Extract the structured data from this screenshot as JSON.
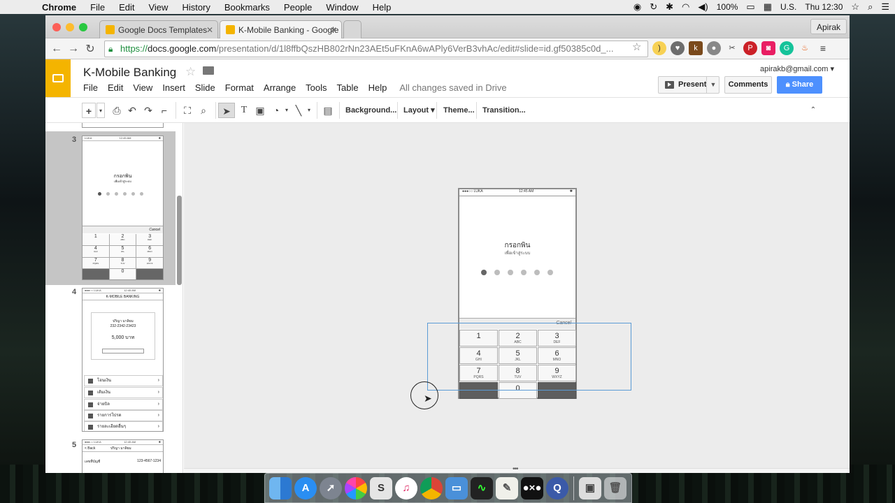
{
  "menubar": {
    "app": "Chrome",
    "items": [
      "File",
      "Edit",
      "View",
      "History",
      "Bookmarks",
      "People",
      "Window",
      "Help"
    ],
    "battery": "100%",
    "input_source": "U.S.",
    "clock": "Thu 12:30"
  },
  "browser": {
    "tabs": [
      {
        "title": "Google Docs Templates",
        "icon_color": "#f4b400"
      },
      {
        "title": "K-Mobile Banking - Google",
        "icon_color": "#f4b400"
      }
    ],
    "profile": "Apirak",
    "url": {
      "scheme": "https://",
      "domain": "docs.google.com",
      "path": "/presentation/d/1l8ffbQszHB802rNn23AEt5uFKnA6wAPly6VerB3vhAc/edit#slide=id.gf50385c0d_..."
    },
    "extensions": [
      "bookmark-icon",
      "pocket-icon",
      "k-icon",
      "ghost-icon",
      "tools-icon",
      "pinterest-icon",
      "camera-icon",
      "grammarly-icon",
      "flame-icon",
      "hamburger-icon"
    ]
  },
  "docs": {
    "title": "K-Mobile Banking",
    "menu": [
      "File",
      "Edit",
      "View",
      "Insert",
      "Slide",
      "Format",
      "Arrange",
      "Tools",
      "Table",
      "Help"
    ],
    "save_status": "All changes saved in Drive",
    "account": "apirakb@gmail.com",
    "present_label": "Present",
    "comments_label": "Comments",
    "share_label": "Share",
    "toolbar_text": {
      "background": "Background...",
      "layout": "Layout",
      "theme": "Theme...",
      "transition": "Transition..."
    }
  },
  "filmstrip": {
    "slide_numbers": [
      "3",
      "4",
      "5"
    ],
    "thumb3": {
      "carrier": "LUKA",
      "time": "12:45 AM",
      "title": "กรอกพิน",
      "subtitle": "เพื่อเข้าสู่ระบบ",
      "cancel": "Cancel"
    },
    "thumb4": {
      "header": "K-MOBILE BANKING",
      "account_name": "ปริญา มาลิยม",
      "account_no": "232-2342-23423",
      "amount": "5,000 บาท",
      "menu": [
        "โอนเงิน",
        "เติมเงิน",
        "จ่ายบิล",
        "รายการโปรด",
        "รายละเอียดอื่นๆ"
      ]
    },
    "thumb5": {
      "back": "< Back",
      "name": "ปริญา มาลิยม",
      "label": "เลขที่บัญชี",
      "value": "123-4567-1234"
    }
  },
  "slide": {
    "status_carrier": "●●●○○ LUKA",
    "status_time": "12:45 AM",
    "status_bt": "✱",
    "title": "กรอกพิน",
    "subtitle": "เพื่อเข้าสู่ระบบ",
    "pin_entered": 1,
    "pin_length": 6,
    "cancel": "Cancel",
    "keys": [
      {
        "n": "1",
        "l": ""
      },
      {
        "n": "2",
        "l": "ABC"
      },
      {
        "n": "3",
        "l": "DEF"
      },
      {
        "n": "4",
        "l": "GHI"
      },
      {
        "n": "5",
        "l": "JKL"
      },
      {
        "n": "6",
        "l": "MNO"
      },
      {
        "n": "7",
        "l": "PQRS"
      },
      {
        "n": "8",
        "l": "TUV"
      },
      {
        "n": "9",
        "l": "WXYZ"
      },
      {
        "n": "",
        "l": ""
      },
      {
        "n": "0",
        "l": ""
      },
      {
        "n": "",
        "l": ""
      }
    ]
  },
  "dock": [
    "finder",
    "app-store",
    "rocket",
    "photos",
    "scrivener",
    "itunes",
    "chrome",
    "keynote",
    "activity",
    "textedit",
    "dot-x",
    "quicktime",
    "preview",
    "trash"
  ]
}
